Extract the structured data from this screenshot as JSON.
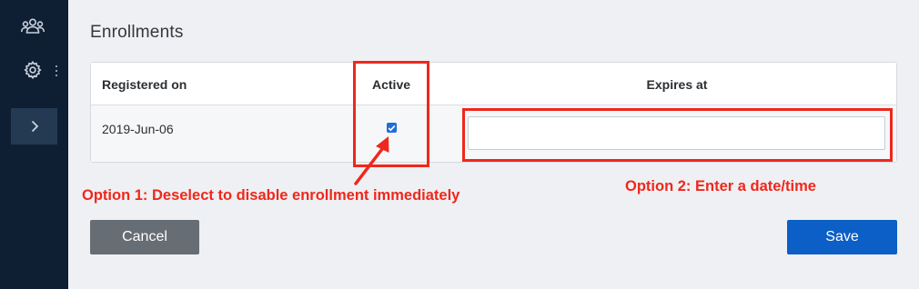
{
  "sidebar": {
    "icons": [
      "users-icon",
      "gear-icon",
      "more-vertical-icon",
      "chevron-right-icon"
    ],
    "bg_color": "#0f1f33"
  },
  "page": {
    "title": "Enrollments"
  },
  "table": {
    "columns": [
      "Registered on",
      "Active",
      "Expires at"
    ],
    "rows": [
      {
        "registered_on": "2019-Jun-06",
        "active": true,
        "expires_at": ""
      }
    ]
  },
  "annotations": {
    "option1": "Option 1: Deselect to disable enrollment immediately",
    "option2": "Option 2: Enter a date/time",
    "color": "#f0271c"
  },
  "buttons": {
    "cancel": "Cancel",
    "save": "Save"
  },
  "colors": {
    "primary": "#0b5fc6",
    "secondary": "#666d74",
    "checkbox": "#1e6fd9"
  }
}
